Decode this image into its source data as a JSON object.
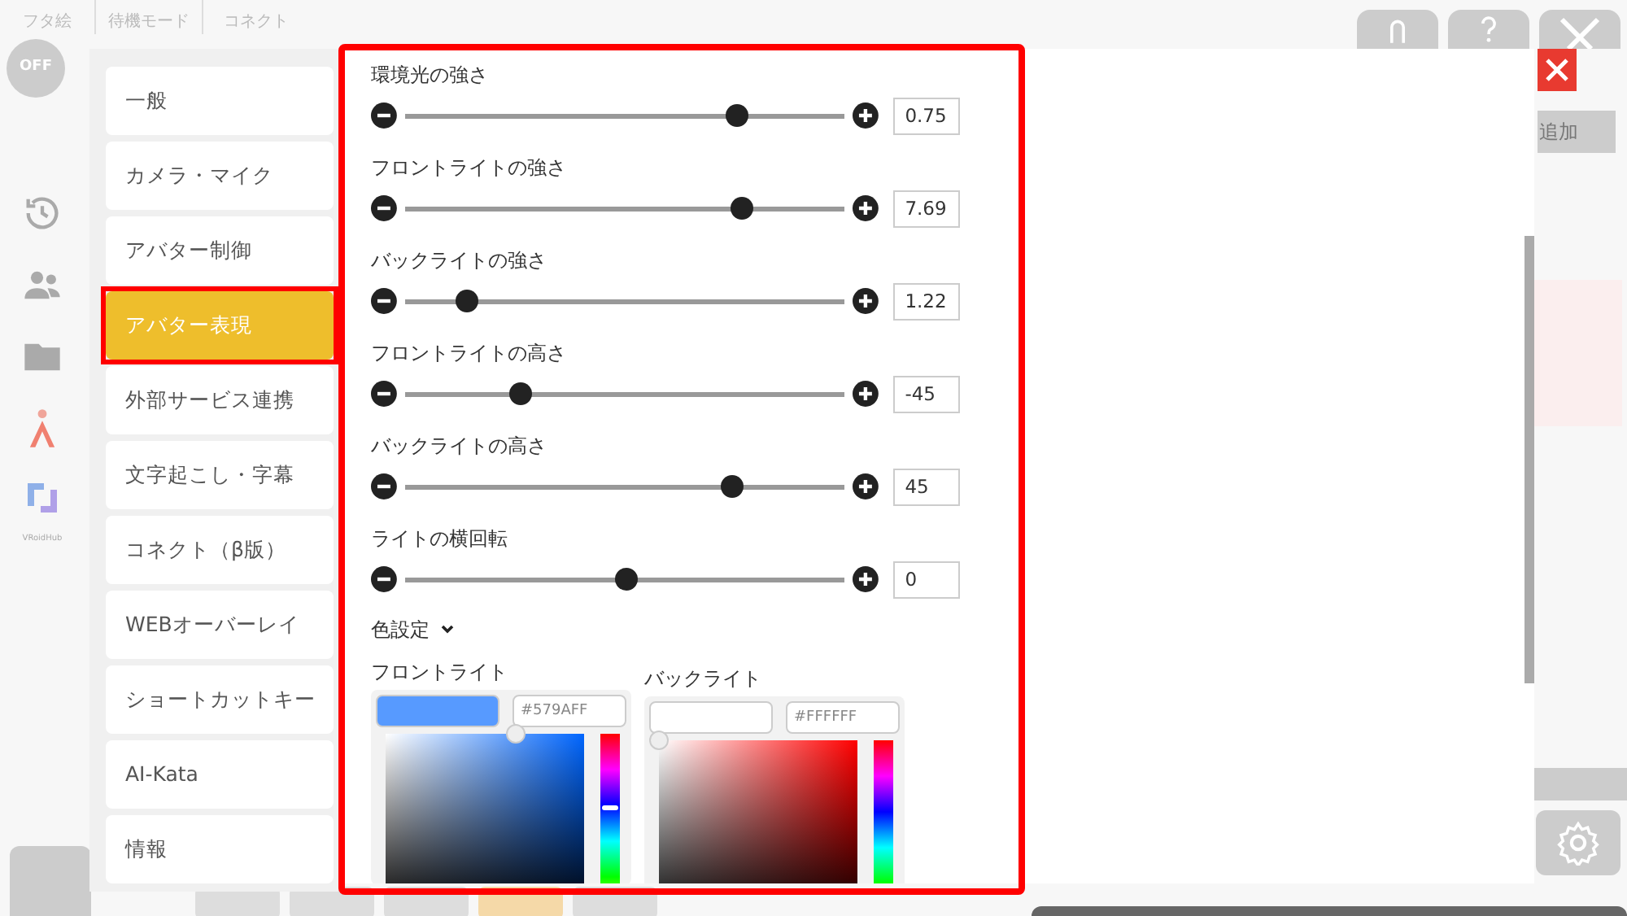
{
  "top_bar": {
    "tabs": [
      {
        "label": "フタ絵"
      },
      {
        "label": "待機モード"
      },
      {
        "label": "コネクト"
      }
    ],
    "toggle": {
      "label": "OFF",
      "on": false
    }
  },
  "rail": {
    "caption": "VRoidHub"
  },
  "menu": [
    {
      "label": "一般",
      "selected": false,
      "highlighted": false
    },
    {
      "label": "カメラ・マイク",
      "selected": false,
      "highlighted": false
    },
    {
      "label": "アバター制御",
      "selected": false,
      "highlighted": false
    },
    {
      "label": "アバター表現",
      "selected": true,
      "highlighted": true
    },
    {
      "label": "外部サービス連携",
      "selected": false,
      "highlighted": false
    },
    {
      "label": "文字起こし・字幕",
      "selected": false,
      "highlighted": false
    },
    {
      "label": "コネクト（β版）",
      "selected": false,
      "highlighted": false
    },
    {
      "label": "WEBオーバーレイ",
      "selected": false,
      "highlighted": false
    },
    {
      "label": "ショートカットキー",
      "selected": false,
      "highlighted": false
    },
    {
      "label": "AI-Kata",
      "selected": false,
      "highlighted": false
    },
    {
      "label": "情報",
      "selected": false,
      "highlighted": false
    }
  ],
  "panel": {
    "highlighted": true,
    "sliders": [
      {
        "label": "環境光の強さ",
        "level": 0.75,
        "value": "0.75"
      },
      {
        "label": "フロントライトの強さ",
        "level": 0.76,
        "value": "7.69"
      },
      {
        "label": "バックライトの強さ",
        "level": 0.14,
        "value": "1.22"
      },
      {
        "label": "フロントライトの高さ",
        "level": 0.26,
        "value": "-45"
      },
      {
        "label": "バックライトの高さ",
        "level": 0.74,
        "value": "45"
      },
      {
        "label": "ライトの横回転",
        "level": 0.5,
        "value": "0"
      }
    ],
    "color_section": {
      "label": "色設定",
      "expanded": true,
      "pickers": [
        {
          "label": "フロントライト",
          "color": "#579aff",
          "hex": "#579AFF"
        },
        {
          "label": "バックライト",
          "color": "#ffffff",
          "hex": "#FFFFFF"
        }
      ]
    }
  },
  "right": {
    "add_button": "追加"
  }
}
